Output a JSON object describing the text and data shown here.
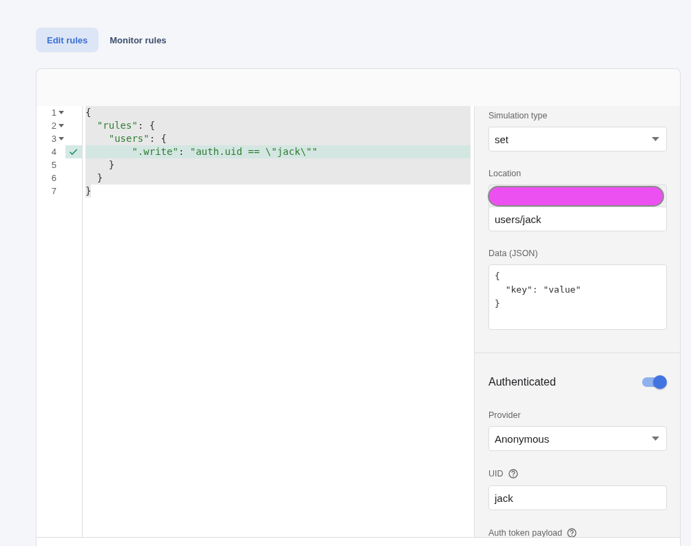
{
  "tabs": [
    {
      "label": "Edit rules",
      "selected": true
    },
    {
      "label": "Monitor rules",
      "selected": false
    }
  ],
  "editor": {
    "lines": [
      {
        "number": "1",
        "code": "{",
        "foldable": true,
        "passed": false,
        "selected": true
      },
      {
        "number": "2",
        "code": "  \"rules\": {",
        "foldable": true,
        "passed": false,
        "selected": true
      },
      {
        "number": "3",
        "code": "    \"users\": {",
        "foldable": true,
        "passed": false,
        "selected": true
      },
      {
        "number": "4",
        "code": "        \".write\": \"auth.uid == \\\"jack\\\"\"",
        "foldable": false,
        "passed": true,
        "selected": true
      },
      {
        "number": "5",
        "code": "    }",
        "foldable": false,
        "passed": false,
        "selected": true
      },
      {
        "number": "6",
        "code": "  }",
        "foldable": false,
        "passed": false,
        "selected": true
      },
      {
        "number": "7",
        "code": "}",
        "foldable": false,
        "passed": false,
        "selected": true
      }
    ]
  },
  "simulator": {
    "request_fields": [
      {
        "kind": "select",
        "label": "Simulation type",
        "value": "set"
      },
      {
        "kind": "location",
        "label": "Location",
        "value": "users/jack",
        "redacted": true
      },
      {
        "kind": "textarea",
        "label": "Data (JSON)",
        "value": "{\n  \"key\": \"value\"\n}"
      }
    ],
    "authenticated": {
      "label": "Authenticated",
      "on": true
    },
    "auth_fields": [
      {
        "kind": "select",
        "label": "Provider",
        "value": "Anonymous",
        "help": false
      },
      {
        "kind": "input",
        "label": "UID",
        "value": "jack",
        "help": true
      },
      {
        "kind": "label",
        "label": "Auth token payload",
        "help": true
      }
    ]
  }
}
